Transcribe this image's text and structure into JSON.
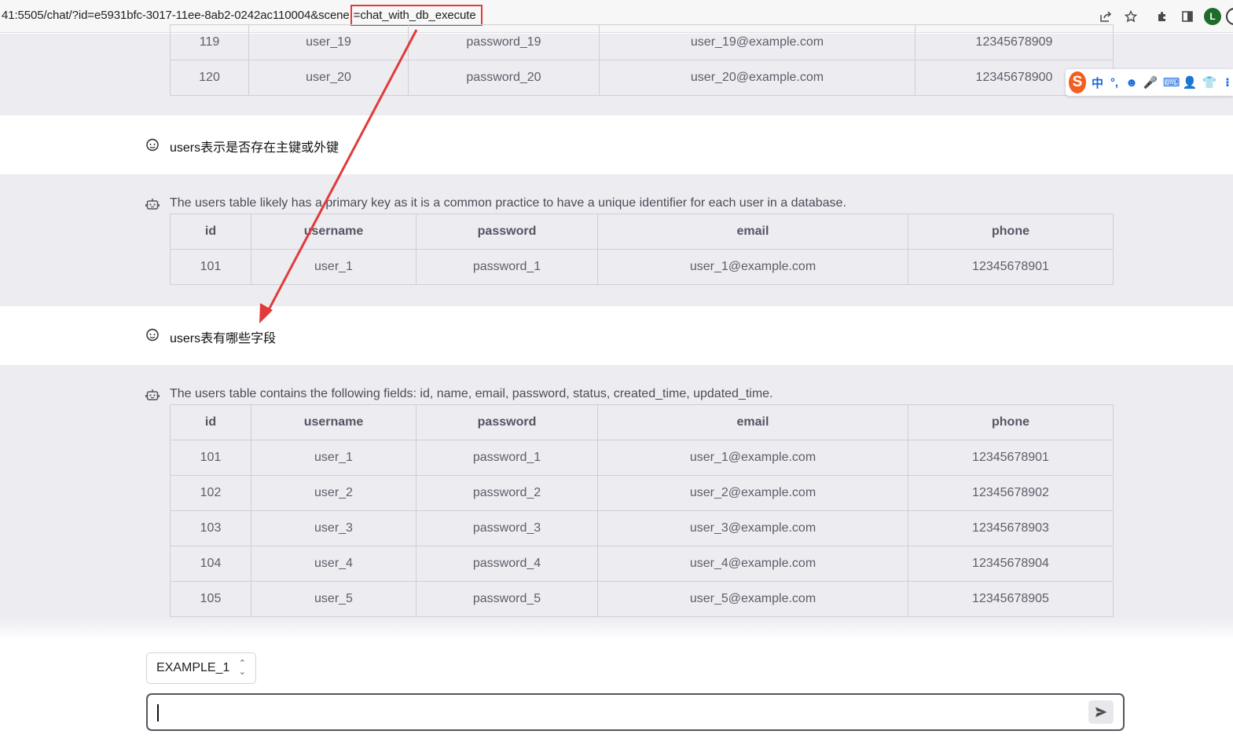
{
  "browser": {
    "url_prefix": "41:5505/chat/?id=e5931bfc-3017-11ee-8ab2-0242ac110004&scene",
    "url_highlight": "=chat_with_db_execute",
    "avatar_letter": "L"
  },
  "ime": {
    "logo": "S",
    "items": [
      "中",
      "°,",
      "☻",
      "🎤",
      "⌨",
      "👤",
      "👕",
      "⁝"
    ]
  },
  "table_top": {
    "rows": [
      [
        "119",
        "user_19",
        "password_19",
        "user_19@example.com",
        "12345678909"
      ],
      [
        "120",
        "user_20",
        "password_20",
        "user_20@example.com",
        "12345678900"
      ]
    ]
  },
  "msg1_user": {
    "text": "users表示是否存在主键或外键"
  },
  "msg1_ai": {
    "text": "The users table likely has a primary key as it is a common practice to have a unique identifier for each user in a database.",
    "headers": [
      "id",
      "username",
      "password",
      "email",
      "phone"
    ],
    "rows": [
      [
        "101",
        "user_1",
        "password_1",
        "user_1@example.com",
        "12345678901"
      ]
    ]
  },
  "msg2_user": {
    "text": "users表有哪些字段"
  },
  "msg2_ai": {
    "text": "The users table contains the following fields: id, name, email, password, status, created_time, updated_time.",
    "headers": [
      "id",
      "username",
      "password",
      "email",
      "phone"
    ],
    "rows": [
      [
        "101",
        "user_1",
        "password_1",
        "user_1@example.com",
        "12345678901"
      ],
      [
        "102",
        "user_2",
        "password_2",
        "user_2@example.com",
        "12345678902"
      ],
      [
        "103",
        "user_3",
        "password_3",
        "user_3@example.com",
        "12345678903"
      ],
      [
        "104",
        "user_4",
        "password_4",
        "user_4@example.com",
        "12345678904"
      ],
      [
        "105",
        "user_5",
        "password_5",
        "user_5@example.com",
        "12345678905"
      ]
    ]
  },
  "footer": {
    "select_value": "EXAMPLE_1",
    "input_value": ""
  },
  "colors": {
    "ai_band": "#ececf1",
    "annotation_red": "#e23a3a",
    "input_border": "#55555e"
  }
}
